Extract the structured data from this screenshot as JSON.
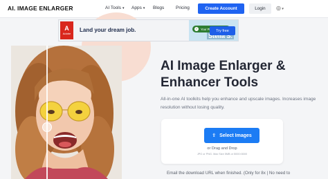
{
  "nav": {
    "logo": "AI. IMAGE ENLARGER",
    "items": [
      {
        "label": "AI Tools",
        "dropdown": true
      },
      {
        "label": "Apps",
        "dropdown": true
      },
      {
        "label": "Blogs",
        "dropdown": false
      },
      {
        "label": "Pricing",
        "dropdown": false
      }
    ],
    "create_account": "Create Account",
    "login": "Login",
    "language_icon": "globe-icon"
  },
  "ad": {
    "brand": "Adobe",
    "headline": "Land your dream job.",
    "pill": "Your PDF is ready",
    "doc_text": "Stella S.",
    "cta": "Try free"
  },
  "hero": {
    "title": "AI Image Enlarger & Enhancer Tools",
    "subtitle": "All-in-one AI toolkits help you enhance and upscale images. Increases image resolution without losing quality."
  },
  "upload": {
    "button": "Select Images",
    "drag_text": "or Drag and Drop",
    "formats": "JPG or PNG. Max Size 5MB or 5000×5000"
  },
  "email_note": "Email the download URL when finished. (Only for 8x | No need to",
  "colors": {
    "primary": "#1f63f1",
    "upload_button": "#1c7cf4",
    "blob": "#f8ddd2"
  }
}
